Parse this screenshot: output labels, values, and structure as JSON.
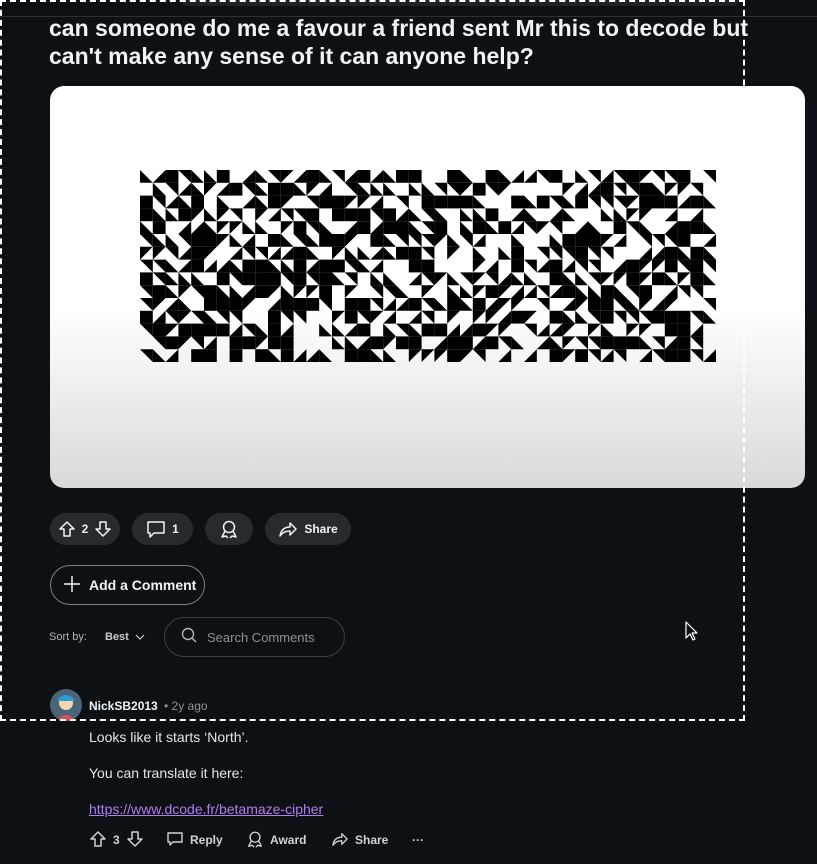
{
  "post": {
    "title": "can someone do me a favour a friend sent Mr this to decode but can't make any sense of it can anyone help?",
    "vote_count": "2",
    "comment_count": "1",
    "share_label": "Share"
  },
  "add_comment_label": "Add a Comment",
  "sort": {
    "label": "Sort by:",
    "value": "Best"
  },
  "search": {
    "placeholder": "Search Comments"
  },
  "comment": {
    "username": "NickSB2013",
    "time": "• 2y ago",
    "lines": [
      "Looks like it starts ‘North’.",
      "You can translate it here:"
    ],
    "link": "https://www.dcode.fr/betamaze-cipher",
    "vote_count": "3",
    "reply_label": "Reply",
    "award_label": "Award",
    "share_label": "Share",
    "more_label": "···"
  },
  "colors": {
    "background": "#0e1113",
    "button": "#272b30",
    "link": "#b07cf2"
  }
}
